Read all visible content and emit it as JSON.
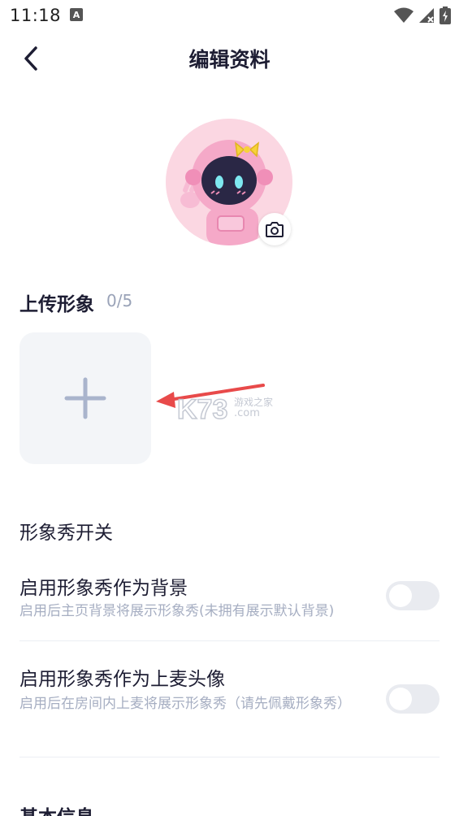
{
  "status_bar": {
    "time": "11:18",
    "notification_badge": "A"
  },
  "header": {
    "title": "编辑资料"
  },
  "upload": {
    "title": "上传形象",
    "count": "0/5"
  },
  "watermark": {
    "text": "K73",
    "subtext": "游戏之家",
    "domain": ".com"
  },
  "toggles_section": {
    "title": "形象秀开关"
  },
  "settings": [
    {
      "title": "启用形象秀作为背景",
      "description": "启用后主页背景将展示形象秀(未拥有展示默认背景)",
      "enabled": false
    },
    {
      "title": "启用形象秀作为上麦头像",
      "description": "启用后在房间内上麦将展示形象秀（请先佩戴形象秀）",
      "enabled": false
    }
  ],
  "next_section": {
    "title": "基本信息"
  },
  "colors": {
    "accent_pink": "#f3a6c4",
    "toggle_off": "#e9ebf0",
    "arrow_red": "#e84a4a"
  }
}
